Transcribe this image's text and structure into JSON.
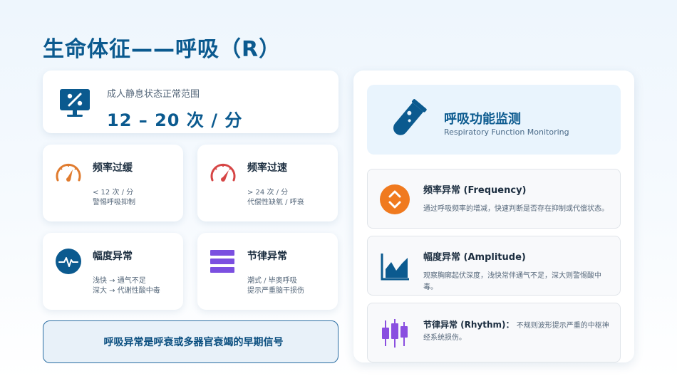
{
  "title": "生命体征——呼吸（R）",
  "normal_range": {
    "label": "成人静息状态正常范围",
    "value": "12 – 20 次 / 分",
    "icon": "monitor-percent-icon"
  },
  "cards": [
    {
      "title": "频率过缓",
      "line1": "< 12 次 / 分",
      "line2": "警惕呼吸抑制",
      "icon": "gauge-slow-icon",
      "color": "#e07b2e"
    },
    {
      "title": "频率过速",
      "line1": "> 24 次 / 分",
      "line2": "代偿性缺氧 / 呼衰",
      "icon": "gauge-fast-icon",
      "color": "#d64545"
    },
    {
      "title": "幅度异常",
      "line1": "浅快 → 通气不足",
      "line2": "深大 → 代谢性酸中毒",
      "icon": "heartbeat-icon",
      "color": "#0b5a8f"
    },
    {
      "title": "节律异常",
      "line1": "潮式 / 毕奥呼吸",
      "line2": "提示严重脑干损伤",
      "icon": "bars-icon",
      "color": "#7b4fe0"
    }
  ],
  "alert": {
    "glyph": "",
    "text": "呼吸异常是呼衰或多器官衰竭的早期信号"
  },
  "panel": {
    "title": "呼吸功能监测",
    "subtitle": "Respiratory Function Monitoring",
    "icon": "test-tube-icon",
    "items": [
      {
        "title": "频率异常 (Frequency)",
        "desc": "通过呼吸频率的增减，快速判断是否存在抑制或代偿状态。",
        "icon": "up-down-arrows-icon",
        "color": "#f07a1f"
      },
      {
        "title": "幅度异常 (Amplitude)",
        "desc": "观察胸廓起伏深度，浅快常伴通气不足，深大则警惕酸中毒。",
        "icon": "area-chart-icon",
        "color": "#0b5a8f"
      },
      {
        "title": "节律异常 (Rhythm)：",
        "desc": "不规则波形提示严重的中枢神经系统损伤。",
        "icon": "candlestick-icon",
        "color": "#8a4fe0"
      }
    ]
  }
}
